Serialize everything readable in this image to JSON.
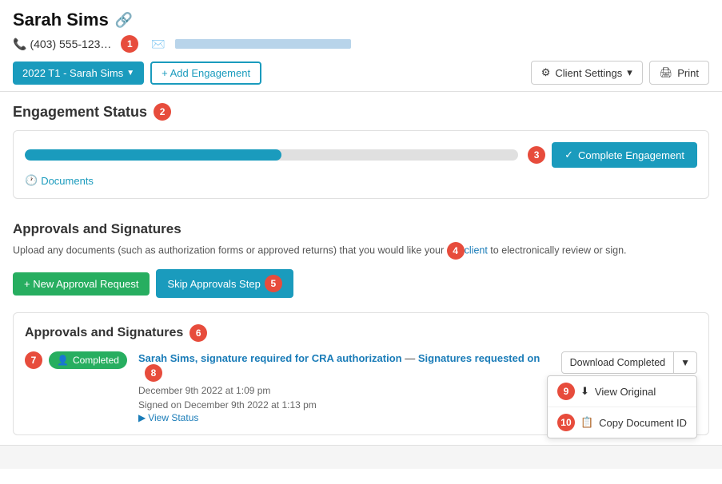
{
  "client": {
    "name": "Sarah Sims",
    "phone": "(403) 555-123…",
    "engagement_label": "2022 T1 - Sarah Sims"
  },
  "toolbar": {
    "add_engagement": "+ Add Engagement",
    "client_settings": "Client Settings",
    "print": "Print"
  },
  "engagement_status": {
    "section_title": "Engagement Status",
    "docs_link": "Documents",
    "complete_btn": "Complete Engagement",
    "progress_pct": 52
  },
  "approvals": {
    "section_title": "Approvals and Signatures",
    "desc_part1": "Upload any documents (such as authorization forms or approved returns) that you would like your ",
    "desc_client": "client",
    "desc_part2": " to electronically review or sign.",
    "new_request_btn": "+ New Approval Request",
    "skip_btn": "Skip Approvals Step",
    "inner_title": "Approvals and Signatures",
    "item": {
      "status": "Completed",
      "title": "Sarah Sims, signature required for CRA authorization",
      "dash": "—",
      "subtitle": "Signatures requested on",
      "date1": "December 9th 2022 at 1:09 pm",
      "date2": "Signed on December 9th 2022 at 1:13 pm",
      "view_status": "View Status",
      "download_btn": "Download Completed",
      "view_original": "View Original",
      "copy_doc_id": "Copy Document ID"
    }
  },
  "annotations": {
    "1": "1",
    "2": "2",
    "3": "3",
    "4": "4",
    "5": "5",
    "6": "6",
    "7": "7",
    "8": "8",
    "9": "9",
    "10": "10"
  }
}
